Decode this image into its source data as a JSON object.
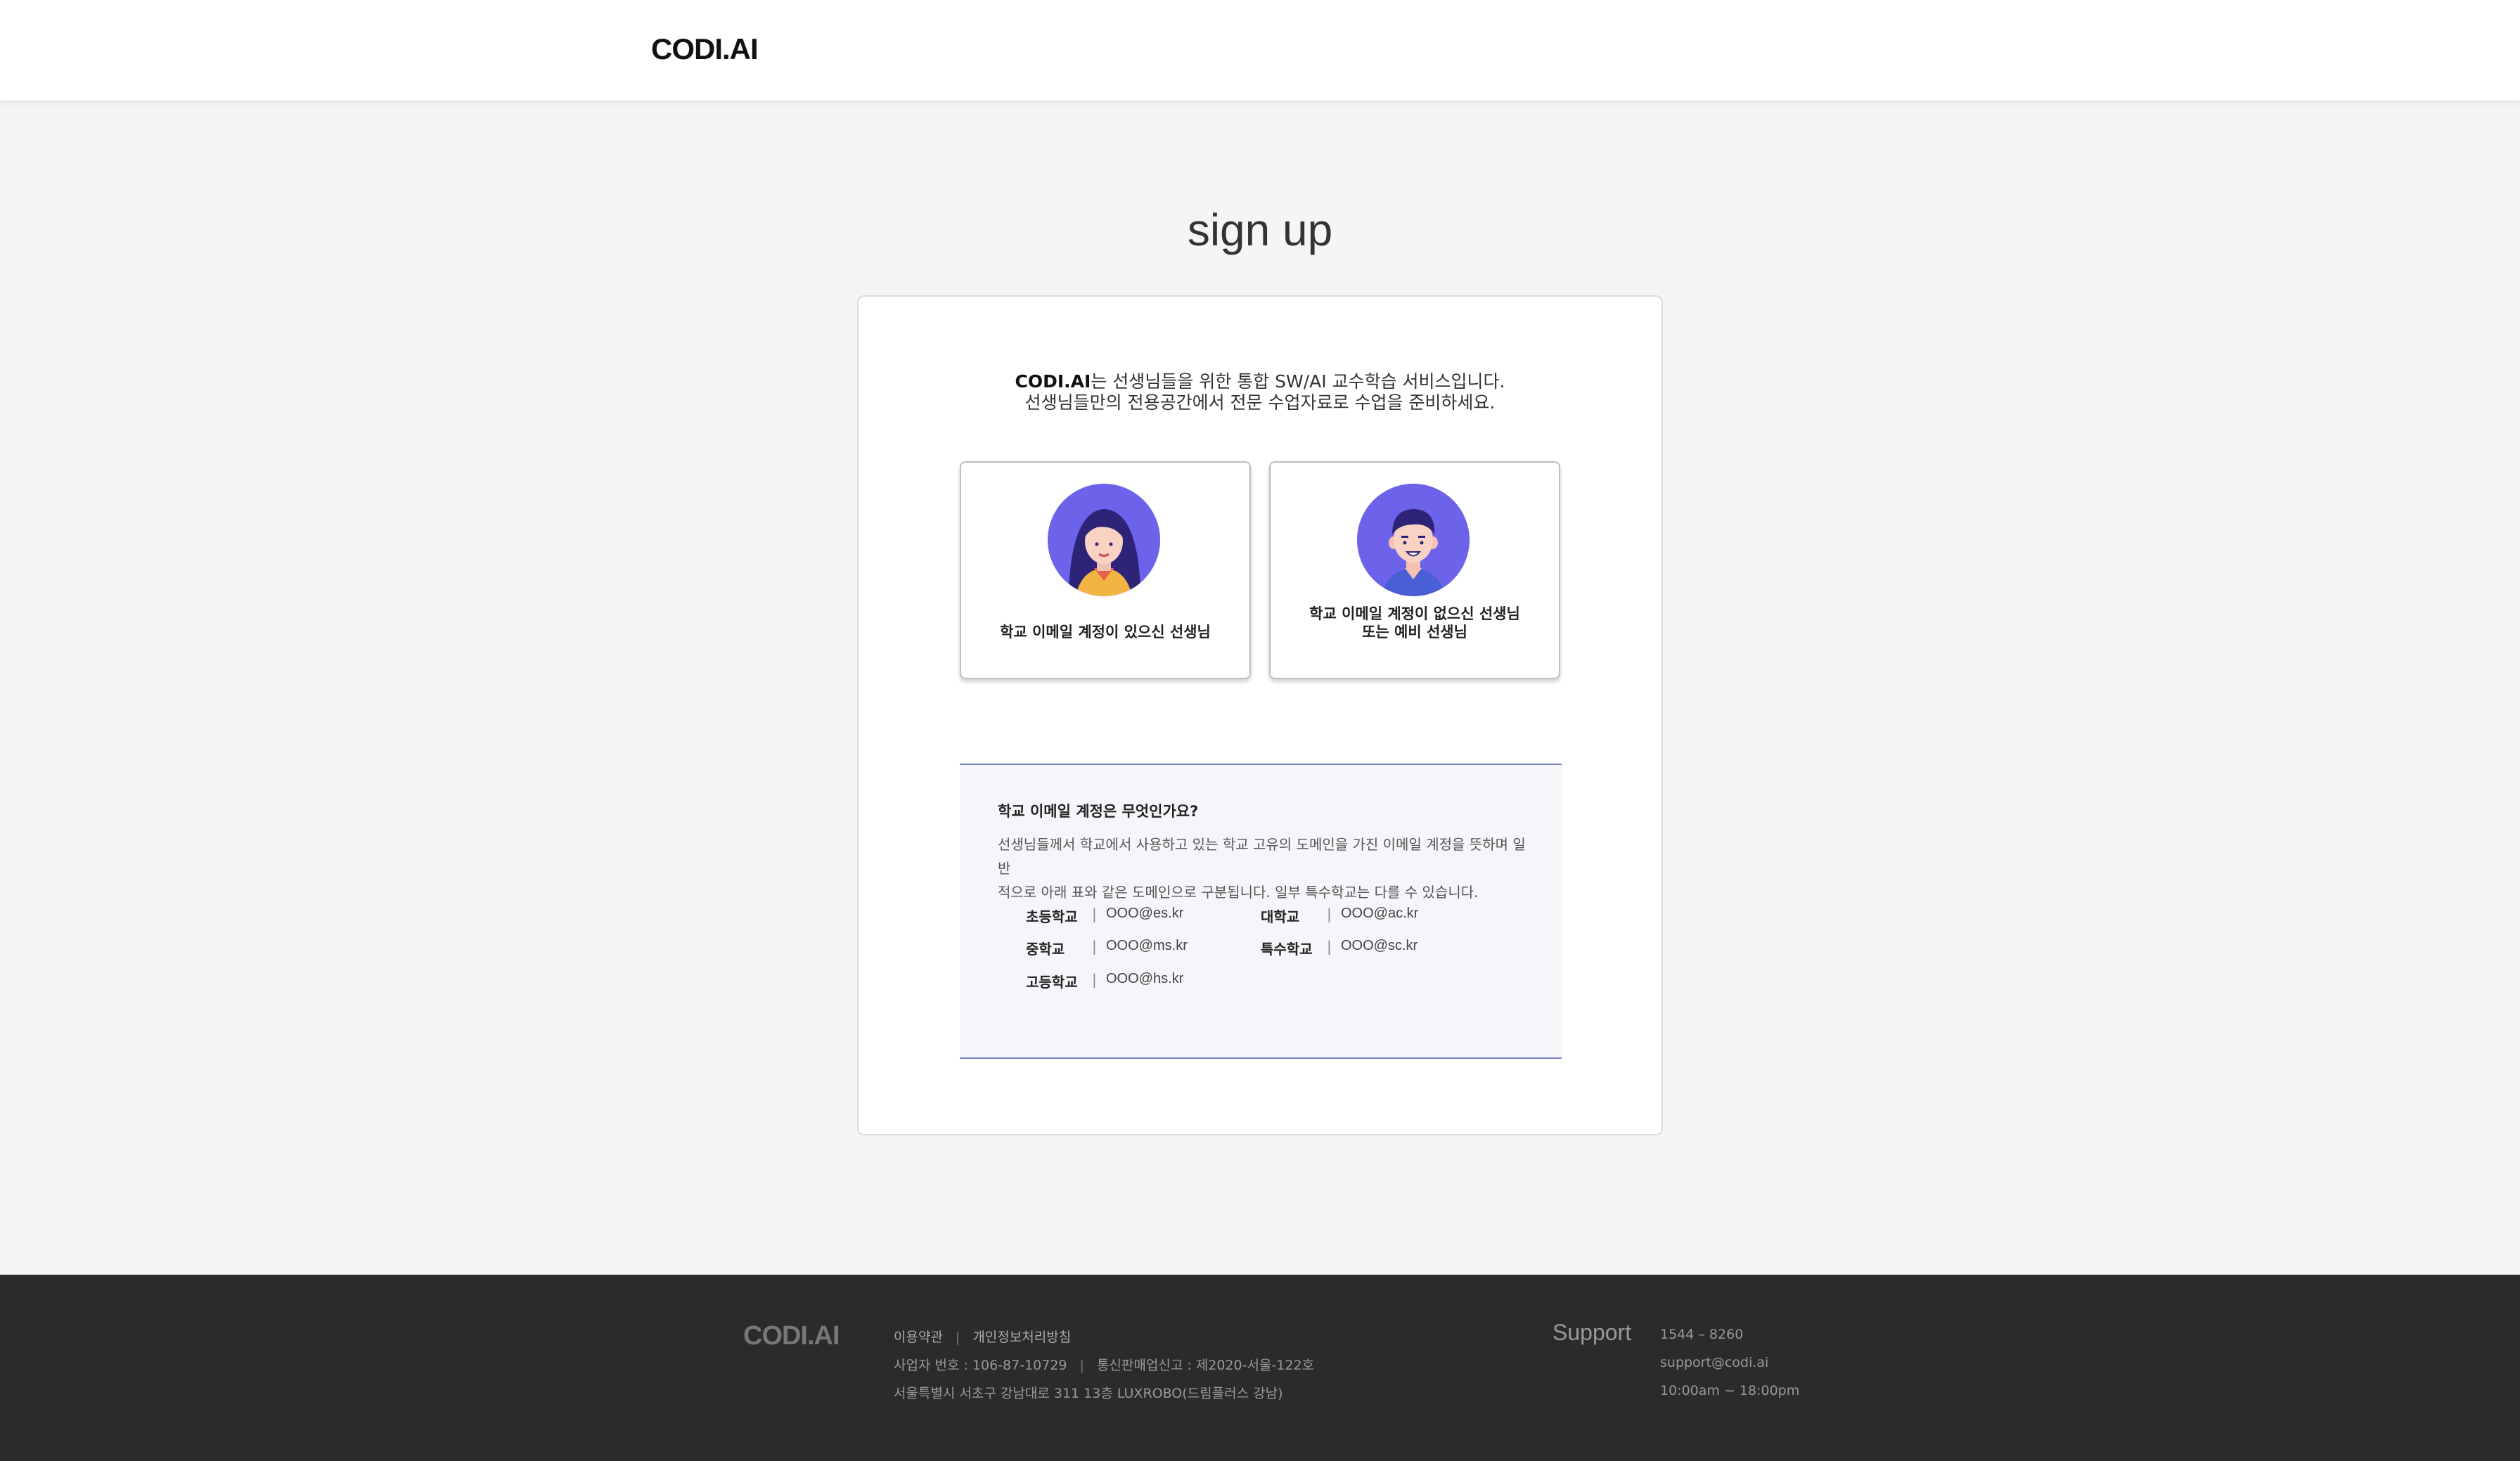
{
  "header": {
    "logo": "CODI.AI"
  },
  "page": {
    "title": "sign up"
  },
  "intro": {
    "brand": "CODI.AI",
    "line1_rest": "는 선생님들을 위한 통합 SW/AI 교수학습 서비스입니다.",
    "line2": "선생님들만의 전용공간에서 전문 수업자료로 수업을 준비하세요."
  },
  "choices": {
    "with_email": {
      "label": "학교 이메일 계정이 있으신 선생님",
      "icon": "teacher-female-icon"
    },
    "without_email": {
      "label_line1": "학교 이메일 계정이 없으신 선생님",
      "label_line2": "또는 예비 선생님",
      "icon": "teacher-male-icon"
    }
  },
  "info": {
    "title": "학교 이메일 계정은 무엇인가요?",
    "desc_line1": "선생님들께서 학교에서 사용하고 있는 학교 고유의 도메인을 가진 이메일 계정을 뜻하며 일반",
    "desc_line2": "적으로 아래 표와 같은 도메인으로 구분됩니다. 일부 특수학교는 다를 수 있습니다.",
    "domains": [
      {
        "level": "초등학교",
        "domain": "OOO@es.kr"
      },
      {
        "level": "대학교",
        "domain": "OOO@ac.kr"
      },
      {
        "level": "중학교",
        "domain": "OOO@ms.kr"
      },
      {
        "level": "특수학교",
        "domain": "OOO@sc.kr"
      },
      {
        "level": "고등학교",
        "domain": "OOO@hs.kr"
      }
    ]
  },
  "footer": {
    "logo": "CODI.AI",
    "terms": "이용약관",
    "privacy": "개인정보처리방침",
    "biz_no": "사업자 번호 : 106-87-10729",
    "ecommerce": "통신판매업신고 : 제2020-서울-122호",
    "address": "서울특별시 서초구 강남대로 311 13층 LUXROBO(드림플러스 강남)",
    "support_title": "Support",
    "phone": "1544 – 8260",
    "email": "support@codi.ai",
    "hours": "10:00am ~ 18:00pm"
  },
  "colors": {
    "accent": "#6c63ea",
    "info_border": "#7b83c8",
    "footer_bg": "#2b2b2b"
  }
}
